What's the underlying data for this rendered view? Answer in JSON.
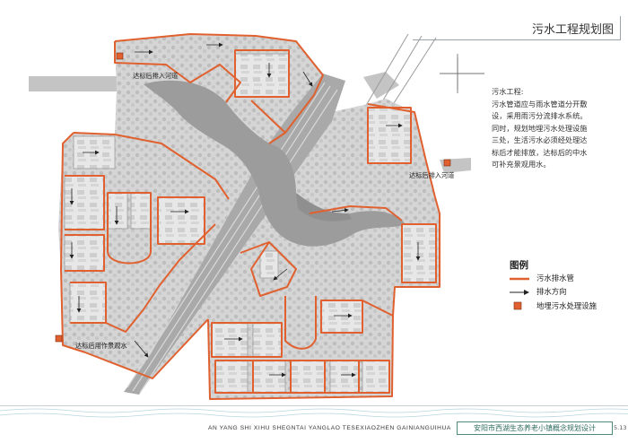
{
  "title": "污水工程规划图",
  "description_heading": "污水工程:",
  "description_lines": [
    "污水管道应与雨水管道分开敷",
    "设，采用雨污分流排水系统。",
    "同时，规划地埋污水处理设施",
    "三处，生活污水必须经处理达",
    "标后才能排放，达标后的中水",
    "可补充景观用水。"
  ],
  "legend": {
    "title": "图例",
    "items": [
      {
        "label": "污水排水管",
        "symbol": "orange-line",
        "color": "#e0612f"
      },
      {
        "label": "排水方向",
        "symbol": "arrow"
      },
      {
        "label": "地埋污水处理设施",
        "symbol": "orange-square",
        "color": "#e0612f"
      }
    ]
  },
  "map_labels": {
    "top": "达标后排入河道",
    "right": "达标后排入河道",
    "bottom": "达标后用作景观水"
  },
  "footer": {
    "english": "AN YANG SHI XIHU SHEGNTAI YANGLAO TESEXIAOZHEN GAINIANGUIHUA",
    "chinese": "安阳市西湖生态养老小镇概念规划设计",
    "page": "5.13"
  },
  "colors": {
    "pipe": "#e0612f",
    "road": "#bfbfbf",
    "lake": "#a9a9a9",
    "blocks": "#d9d9d9",
    "accent": "#4d8a7c"
  }
}
